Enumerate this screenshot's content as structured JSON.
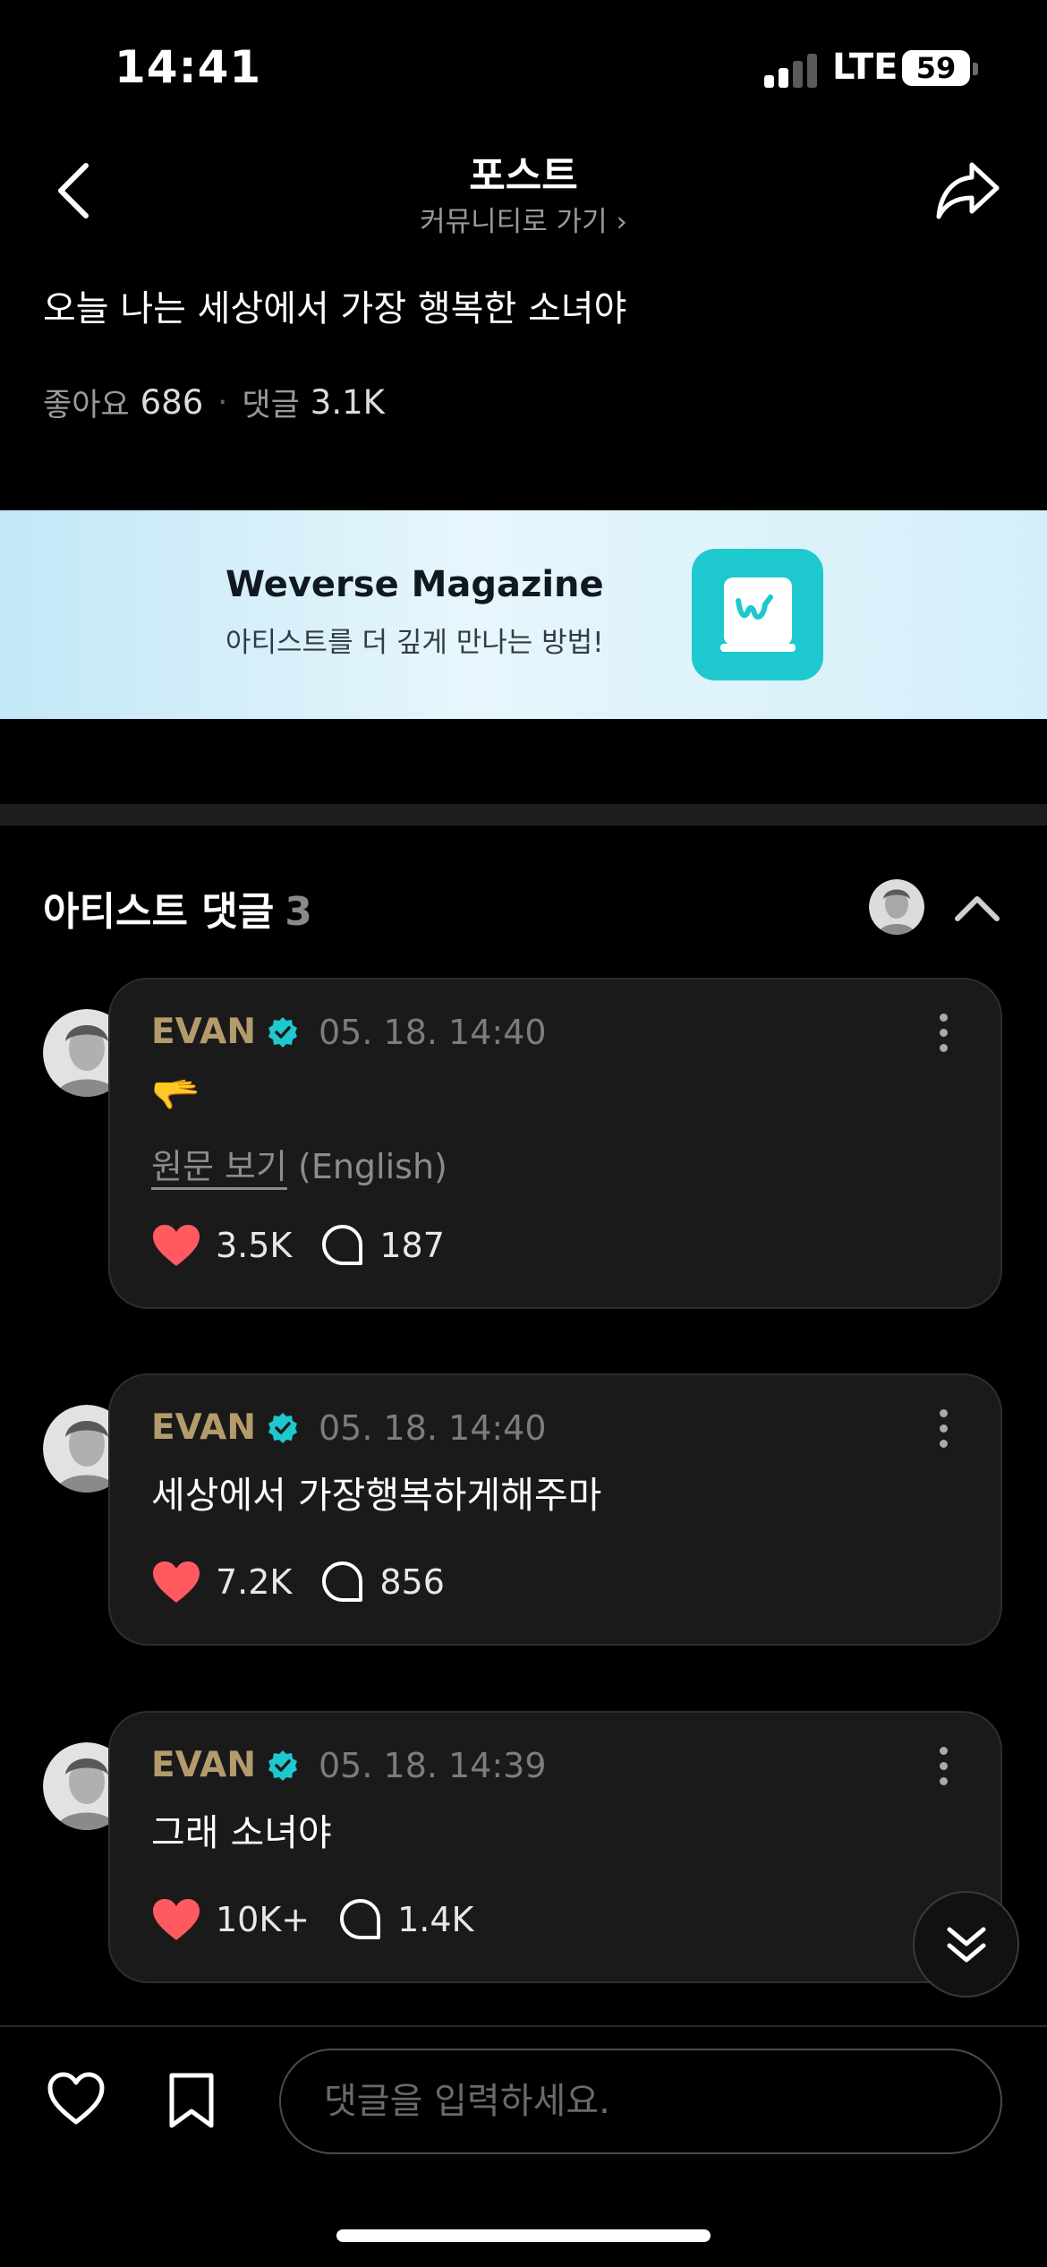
{
  "status_bar": {
    "time": "14:41",
    "network": "LTE",
    "battery": "59"
  },
  "header": {
    "title": "포스트",
    "subtitle": "커뮤니티로 가기 ›",
    "back_icon": "chevron-left-icon",
    "share_icon": "share-arrow-icon"
  },
  "post": {
    "text": "오늘 나는 세상에서 가장 행복한 소녀야",
    "likes_label": "좋아요",
    "likes_count": "686",
    "separator": "·",
    "comments_label": "댓글",
    "comments_count": "3.1K"
  },
  "banner": {
    "title": "Weverse Magazine",
    "subtitle": "아티스트를 더 깊게 만나는 방법!",
    "logo_icon": "weverse-magazine-logo",
    "logo_color": "#1ec8cf"
  },
  "artist_comments": {
    "title": "아티스트 댓글",
    "count": "3",
    "comments": [
      {
        "name": "EVAN",
        "date": "05. 18. 14:40",
        "text": "🫳",
        "translate_link": "원문 보기",
        "translate_lang": "(English)",
        "likes": "3.5K",
        "replies": "187"
      },
      {
        "name": "EVAN",
        "date": "05. 18. 14:40",
        "text": "세상에서 가장행복하게해주마",
        "likes": "7.2K",
        "replies": "856"
      },
      {
        "name": "EVAN",
        "date": "05. 18. 14:39",
        "text": "그래 소녀야",
        "likes": "10K+",
        "replies": "1.4K"
      }
    ]
  },
  "bottom_bar": {
    "input_placeholder": "댓글을 입력하세요."
  },
  "colors": {
    "background": "#000000",
    "artist_name": "#b49b6b",
    "verified_badge": "#1ec8cf",
    "heart": "#ff5a5f",
    "card": "#1a1a1a"
  }
}
